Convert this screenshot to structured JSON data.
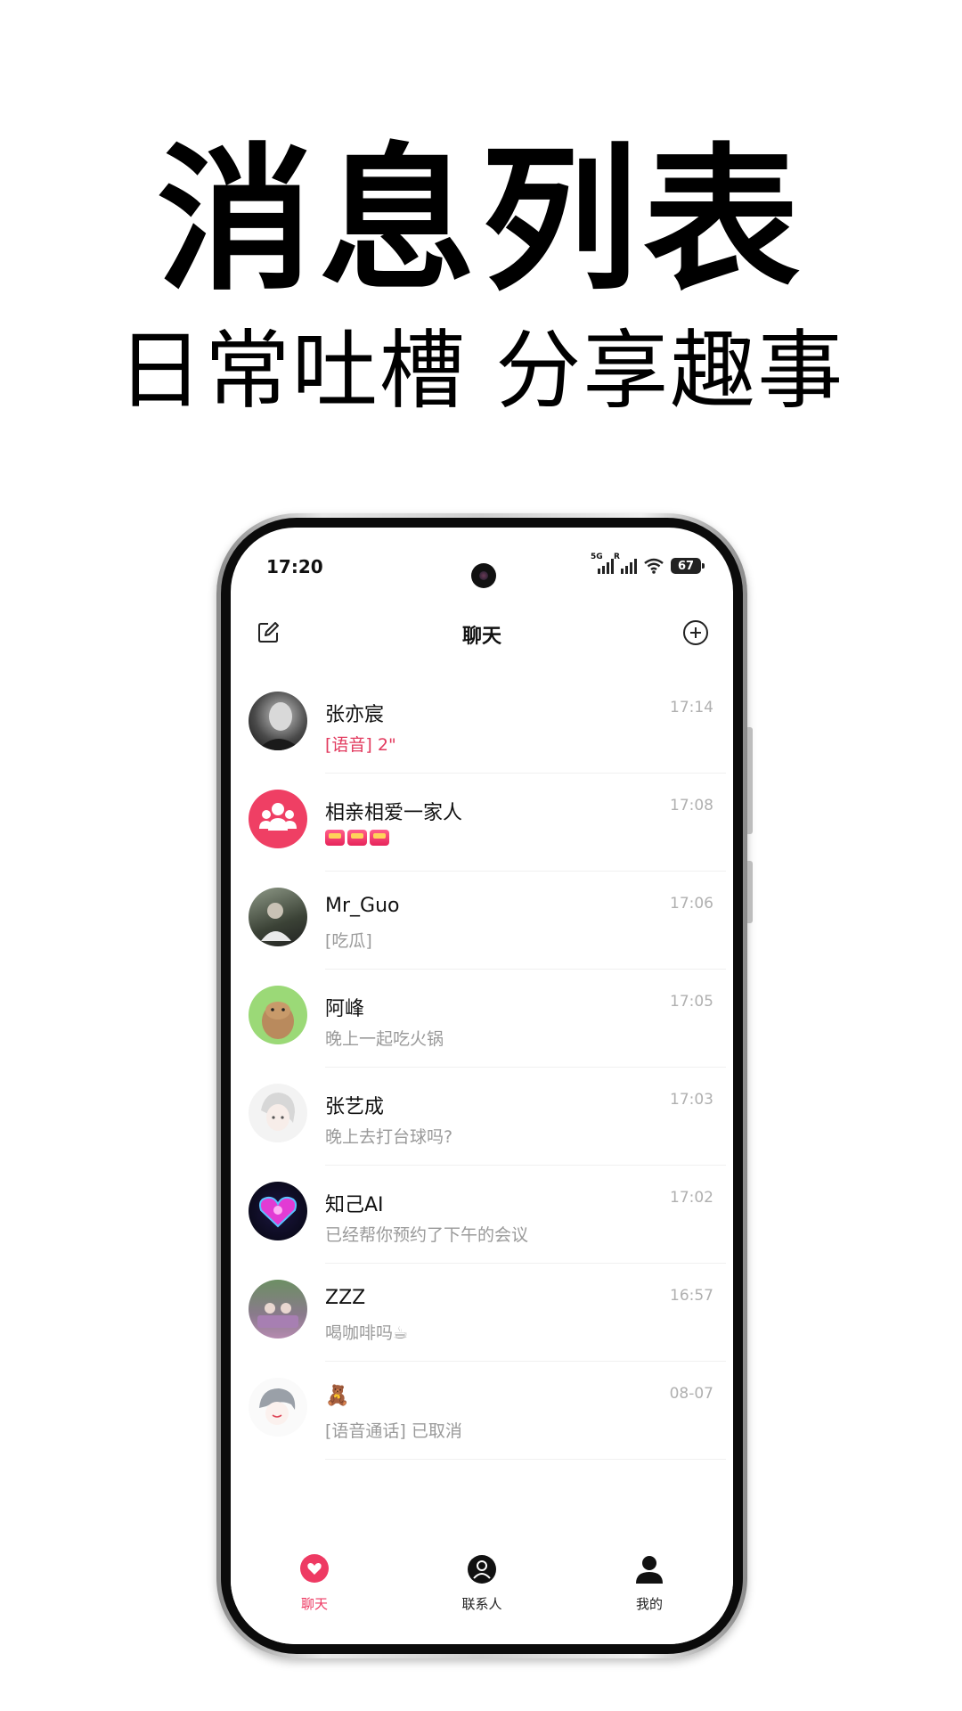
{
  "hero": {
    "title": "消息列表",
    "subtitle": "日常吐槽 分享趣事"
  },
  "statusbar": {
    "time": "17:20",
    "battery": "67",
    "sig1_label": "5G",
    "sig2_label": "R"
  },
  "navbar": {
    "title": "聊天"
  },
  "chats": [
    {
      "name": "张亦宸",
      "message": "[语音] 2\"",
      "time": "17:14",
      "message_style": "red"
    },
    {
      "name": "相亲相爱一家人",
      "message": "",
      "time": "17:08",
      "message_style": "badges"
    },
    {
      "name": "Mr_Guo",
      "message": "[吃瓜]",
      "time": "17:06"
    },
    {
      "name": "阿峰",
      "message": "晚上一起吃火锅",
      "time": "17:05"
    },
    {
      "name": "张艺成",
      "message": "晚上去打台球吗?",
      "time": "17:03"
    },
    {
      "name": "知己AI",
      "message": "已经帮你预约了下午的会议",
      "time": "17:02"
    },
    {
      "name": "ZZZ",
      "message": "喝咖啡吗☕",
      "time": "16:57"
    },
    {
      "name": "🧸",
      "message": "[语音通话] 已取消",
      "time": "08-07"
    }
  ],
  "tabs": [
    {
      "label": "聊天",
      "icon": "chat-bubble-icon"
    },
    {
      "label": "联系人",
      "icon": "contacts-icon"
    },
    {
      "label": "我的",
      "icon": "profile-icon"
    }
  ],
  "colors": {
    "accent": "#ee3a63",
    "group_avatar": "#ef3f64",
    "muted": "#9a9a9a"
  }
}
